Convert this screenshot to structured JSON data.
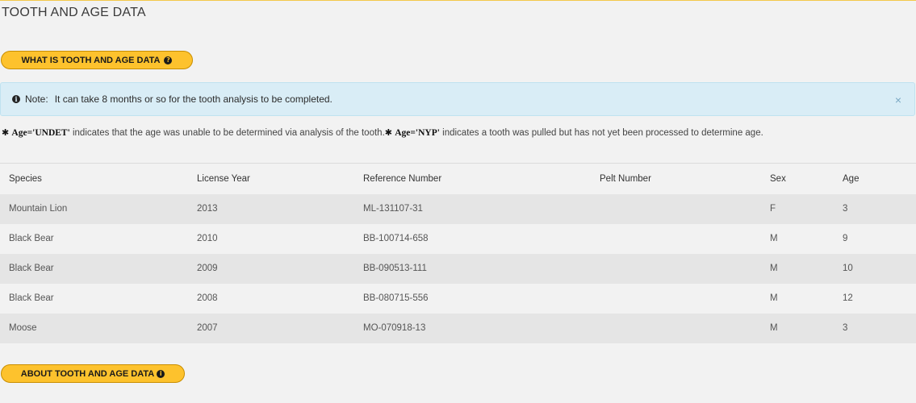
{
  "page": {
    "title": "TOOTH AND AGE DATA"
  },
  "buttons": {
    "what_label": "WHAT IS TOOTH AND AGE DATA",
    "what_icon": "question-circle-icon",
    "about_label": "ABOUT TOOTH AND AGE DATA",
    "about_icon": "info-circle-icon"
  },
  "alert": {
    "label": "Note:",
    "text": "It can take 8 months or so for the tooth analysis to be completed.",
    "close_glyph": "×",
    "background": "#d9edf6"
  },
  "legend": {
    "undet_code": "Age='UNDET'",
    "undet_text": "indicates that the age was unable to be determined via analysis of the tooth.",
    "nyp_code": "Age='NYP'",
    "nyp_text": "indicates a tooth was pulled but has not yet been processed to determine age."
  },
  "table": {
    "headers": {
      "species": "Species",
      "license_year": "License Year",
      "reference_number": "Reference Number",
      "pelt_number": "Pelt Number",
      "sex": "Sex",
      "age": "Age"
    },
    "rows": [
      {
        "species": "Mountain Lion",
        "license_year": "2013",
        "reference_number": "ML-131107-31",
        "pelt_number": "",
        "sex": "F",
        "age": "3"
      },
      {
        "species": "Black Bear",
        "license_year": "2010",
        "reference_number": "BB-100714-658",
        "pelt_number": "",
        "sex": "M",
        "age": "9"
      },
      {
        "species": "Black Bear",
        "license_year": "2009",
        "reference_number": "BB-090513-111",
        "pelt_number": "",
        "sex": "M",
        "age": "10"
      },
      {
        "species": "Black Bear",
        "license_year": "2008",
        "reference_number": "BB-080715-556",
        "pelt_number": "",
        "sex": "M",
        "age": "12"
      },
      {
        "species": "Moose",
        "license_year": "2007",
        "reference_number": "MO-070918-13",
        "pelt_number": "",
        "sex": "M",
        "age": "3"
      }
    ]
  },
  "colors": {
    "button_yellow": "#fdc22d",
    "page_background": "#f2f2f2",
    "row_stripe": "#e5e5e5"
  }
}
